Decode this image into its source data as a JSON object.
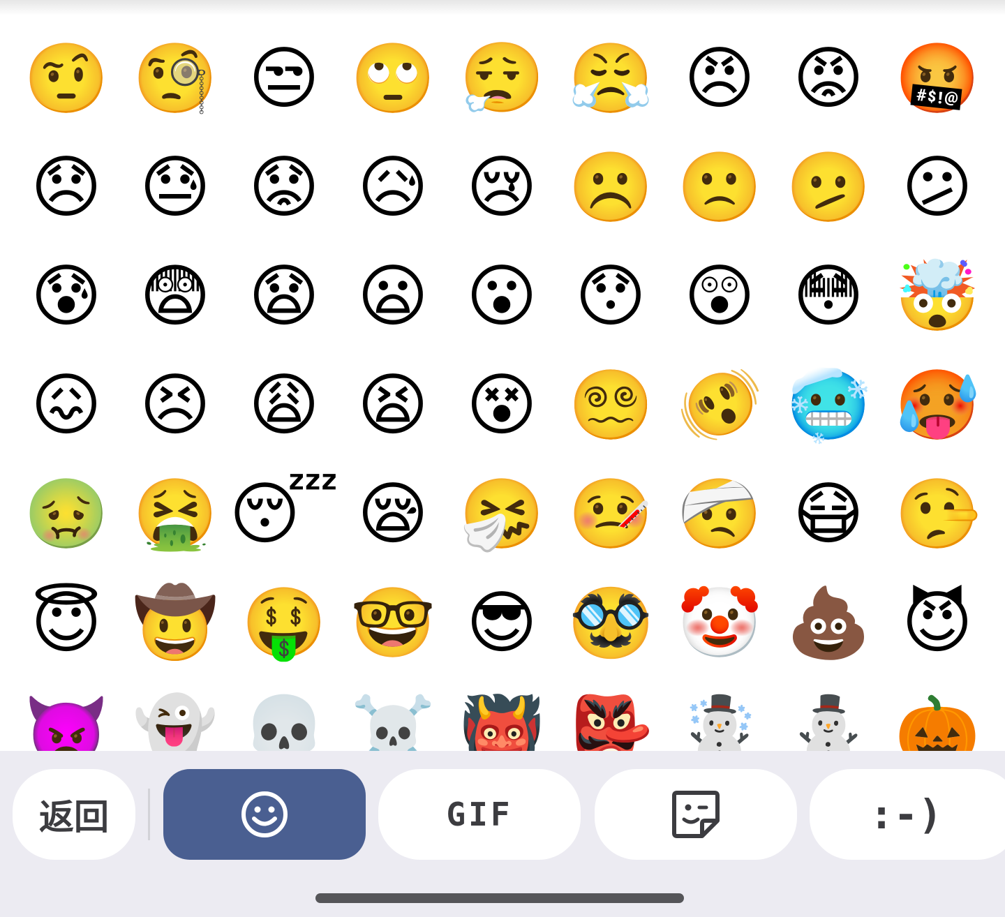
{
  "emoji_grid": {
    "rows": [
      [
        "🤨",
        "🧐",
        "😒",
        "🙄",
        "😮‍💨",
        "😤",
        "😠",
        "😡",
        "🤬"
      ],
      [
        "😞",
        "😓",
        "😟",
        "😥",
        "😢",
        "☹️",
        "🙁",
        "🫤",
        "😕"
      ],
      [
        "😰",
        "😨",
        "😧",
        "😦",
        "😮",
        "😯",
        "😲",
        "😳",
        "🤯"
      ],
      [
        "😖",
        "😣",
        "😩",
        "😫",
        "😵",
        "😵‍💫",
        "🫨",
        "🥶",
        "🥵"
      ],
      [
        "🤢",
        "🤮",
        "😴",
        "😪",
        "🤧",
        "🤒",
        "🤕",
        "😷",
        "🤥"
      ],
      [
        "😇",
        "🤠",
        "🤑",
        "🤓",
        "😎",
        "🥸",
        "🤡",
        "💩",
        "😈"
      ],
      [
        "👿",
        "👻",
        "💀",
        "☠️",
        "👹",
        "👺",
        "☃️",
        "⛄",
        "🎃"
      ]
    ]
  },
  "toolbar": {
    "back_label": "返回",
    "gif_label": "GIF",
    "emoticon_label": ":-)"
  },
  "colors": {
    "active_tab": "#4a5f91",
    "bar_background": "#ecebf2",
    "pill_background": "#ffffff",
    "text": "#3c3c40"
  },
  "icons": {
    "emoji_tab": "smiley-icon",
    "sticker_tab": "sticker-icon"
  }
}
